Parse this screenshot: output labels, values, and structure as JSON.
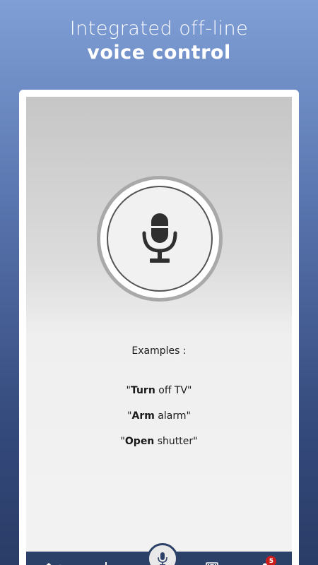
{
  "headline": {
    "line1": "Integrated off-line",
    "line2": "voice control"
  },
  "examples": {
    "title": "Examples :",
    "items": [
      {
        "open_quote": "\"",
        "bold": "Turn",
        "rest": " off TV\""
      },
      {
        "open_quote": "\"",
        "bold": "Arm",
        "rest": " alarm\""
      },
      {
        "open_quote": "\"",
        "bold": "Open",
        "rest": " shutter\""
      }
    ]
  },
  "nav": {
    "items": [
      "home-icon",
      "add-icon",
      "mic-icon",
      "scenes-icon",
      "user-icon"
    ],
    "home_caret": "^",
    "badge_count": "5"
  },
  "colors": {
    "nav_bg": "#2c4168",
    "badge": "#cc1d1d",
    "mic_icon": "#2f2f2f"
  }
}
